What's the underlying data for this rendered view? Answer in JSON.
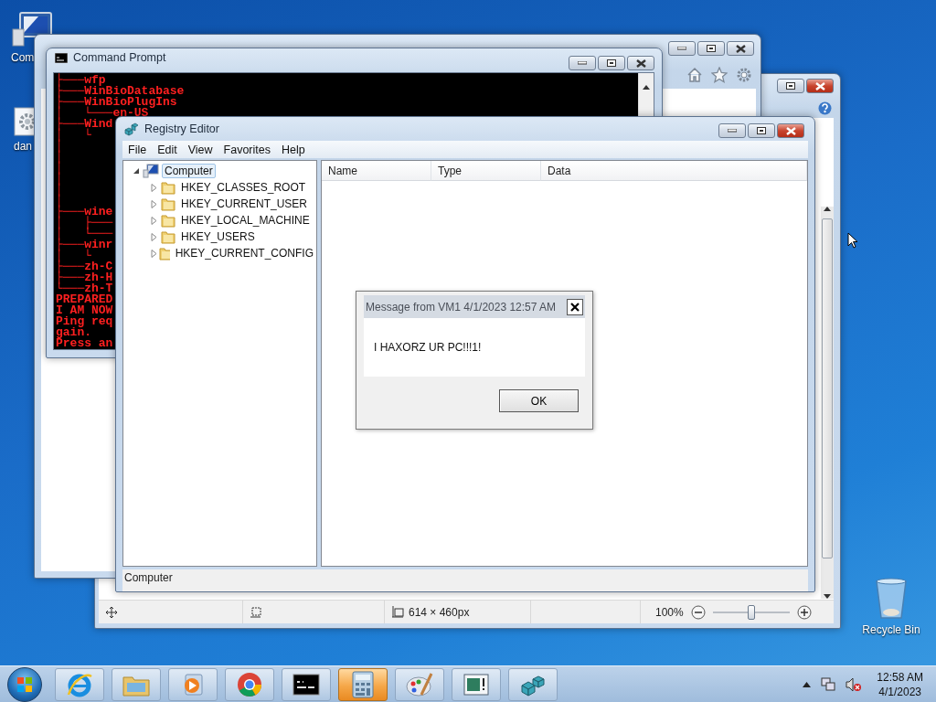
{
  "desktop_icons": [
    {
      "label": "Com",
      "kind": "computer"
    },
    {
      "label": "dan",
      "kind": "settings"
    },
    {
      "label": "Recycle Bin",
      "kind": "recycle"
    }
  ],
  "paint_window": {
    "status_bar": {
      "dimensions": "614 × 460px",
      "zoom": "100%",
      "zoom_slider": {
        "level": 0.5
      }
    }
  },
  "command_prompt": {
    "title": "Command Prompt",
    "lines": [
      "├───wfp",
      "├───WinBioDatabase",
      "├───WinBioPlugIns",
      "│   └───en-US",
      "├───Wind",
      "│   └",
      "│",
      "│",
      "│",
      "│",
      "│",
      "│",
      "├───wine",
      "│   ├───",
      "│   └───",
      "├───winr",
      "│   └",
      "├───zh-C",
      "├───zh-H",
      "└───zh-T",
      "PREPARED",
      "I AM NOW",
      "Ping req",
      "gain.",
      "Press an"
    ]
  },
  "registry_editor": {
    "title": "Registry Editor",
    "menu": [
      "File",
      "Edit",
      "View",
      "Favorites",
      "Help"
    ],
    "tree": {
      "label": "Computer",
      "expanded": true,
      "selected": true,
      "children": [
        {
          "label": "HKEY_CLASSES_ROOT",
          "expanded": false,
          "selected": false
        },
        {
          "label": "HKEY_CURRENT_USER",
          "expanded": false,
          "selected": false
        },
        {
          "label": "HKEY_LOCAL_MACHINE",
          "expanded": false,
          "selected": false
        },
        {
          "label": "HKEY_USERS",
          "expanded": false,
          "selected": false
        },
        {
          "label": "HKEY_CURRENT_CONFIG",
          "expanded": false,
          "selected": false
        }
      ]
    },
    "columns": [
      "Name",
      "Type",
      "Data"
    ],
    "status_bar": "Computer"
  },
  "message_dialog": {
    "title": "Message from VM1 4/1/2023 12:57 AM",
    "message": "I HAXORZ UR PC!!!1!",
    "button": "OK"
  },
  "taskbar": {
    "items": [
      {
        "kind": "ie",
        "highlighted": false
      },
      {
        "kind": "folder",
        "highlighted": false
      },
      {
        "kind": "media",
        "highlighted": false
      },
      {
        "kind": "chrome",
        "highlighted": false
      },
      {
        "kind": "cmd",
        "highlighted": false
      },
      {
        "kind": "calculator",
        "highlighted": true
      },
      {
        "kind": "paint",
        "highlighted": false
      },
      {
        "kind": "console",
        "highlighted": false
      },
      {
        "kind": "registry",
        "highlighted": false
      }
    ],
    "clock": {
      "time": "12:58 AM",
      "date": "4/1/2023"
    }
  }
}
